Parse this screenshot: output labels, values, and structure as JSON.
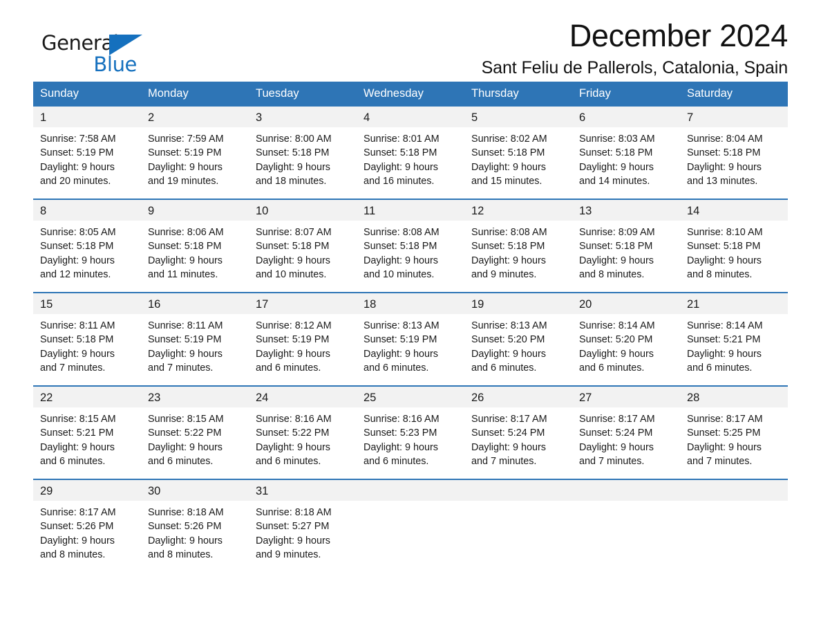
{
  "brand": {
    "name_top": "General",
    "name_bottom": "Blue",
    "accent_color": "#1570BE",
    "logo_icon": "triangle-logo-icon"
  },
  "header": {
    "month_title": "December 2024",
    "location": "Sant Feliu de Pallerols, Catalonia, Spain"
  },
  "theme": {
    "header_blue": "#2E75B6",
    "daynum_bg": "#F2F2F2",
    "text": "#1a1a1a"
  },
  "calendar": {
    "weekdays": [
      "Sunday",
      "Monday",
      "Tuesday",
      "Wednesday",
      "Thursday",
      "Friday",
      "Saturday"
    ],
    "weeks": [
      [
        {
          "day": "1",
          "sunrise": "Sunrise: 7:58 AM",
          "sunset": "Sunset: 5:19 PM",
          "daylight1": "Daylight: 9 hours",
          "daylight2": "and 20 minutes."
        },
        {
          "day": "2",
          "sunrise": "Sunrise: 7:59 AM",
          "sunset": "Sunset: 5:19 PM",
          "daylight1": "Daylight: 9 hours",
          "daylight2": "and 19 minutes."
        },
        {
          "day": "3",
          "sunrise": "Sunrise: 8:00 AM",
          "sunset": "Sunset: 5:18 PM",
          "daylight1": "Daylight: 9 hours",
          "daylight2": "and 18 minutes."
        },
        {
          "day": "4",
          "sunrise": "Sunrise: 8:01 AM",
          "sunset": "Sunset: 5:18 PM",
          "daylight1": "Daylight: 9 hours",
          "daylight2": "and 16 minutes."
        },
        {
          "day": "5",
          "sunrise": "Sunrise: 8:02 AM",
          "sunset": "Sunset: 5:18 PM",
          "daylight1": "Daylight: 9 hours",
          "daylight2": "and 15 minutes."
        },
        {
          "day": "6",
          "sunrise": "Sunrise: 8:03 AM",
          "sunset": "Sunset: 5:18 PM",
          "daylight1": "Daylight: 9 hours",
          "daylight2": "and 14 minutes."
        },
        {
          "day": "7",
          "sunrise": "Sunrise: 8:04 AM",
          "sunset": "Sunset: 5:18 PM",
          "daylight1": "Daylight: 9 hours",
          "daylight2": "and 13 minutes."
        }
      ],
      [
        {
          "day": "8",
          "sunrise": "Sunrise: 8:05 AM",
          "sunset": "Sunset: 5:18 PM",
          "daylight1": "Daylight: 9 hours",
          "daylight2": "and 12 minutes."
        },
        {
          "day": "9",
          "sunrise": "Sunrise: 8:06 AM",
          "sunset": "Sunset: 5:18 PM",
          "daylight1": "Daylight: 9 hours",
          "daylight2": "and 11 minutes."
        },
        {
          "day": "10",
          "sunrise": "Sunrise: 8:07 AM",
          "sunset": "Sunset: 5:18 PM",
          "daylight1": "Daylight: 9 hours",
          "daylight2": "and 10 minutes."
        },
        {
          "day": "11",
          "sunrise": "Sunrise: 8:08 AM",
          "sunset": "Sunset: 5:18 PM",
          "daylight1": "Daylight: 9 hours",
          "daylight2": "and 10 minutes."
        },
        {
          "day": "12",
          "sunrise": "Sunrise: 8:08 AM",
          "sunset": "Sunset: 5:18 PM",
          "daylight1": "Daylight: 9 hours",
          "daylight2": "and 9 minutes."
        },
        {
          "day": "13",
          "sunrise": "Sunrise: 8:09 AM",
          "sunset": "Sunset: 5:18 PM",
          "daylight1": "Daylight: 9 hours",
          "daylight2": "and 8 minutes."
        },
        {
          "day": "14",
          "sunrise": "Sunrise: 8:10 AM",
          "sunset": "Sunset: 5:18 PM",
          "daylight1": "Daylight: 9 hours",
          "daylight2": "and 8 minutes."
        }
      ],
      [
        {
          "day": "15",
          "sunrise": "Sunrise: 8:11 AM",
          "sunset": "Sunset: 5:18 PM",
          "daylight1": "Daylight: 9 hours",
          "daylight2": "and 7 minutes."
        },
        {
          "day": "16",
          "sunrise": "Sunrise: 8:11 AM",
          "sunset": "Sunset: 5:19 PM",
          "daylight1": "Daylight: 9 hours",
          "daylight2": "and 7 minutes."
        },
        {
          "day": "17",
          "sunrise": "Sunrise: 8:12 AM",
          "sunset": "Sunset: 5:19 PM",
          "daylight1": "Daylight: 9 hours",
          "daylight2": "and 6 minutes."
        },
        {
          "day": "18",
          "sunrise": "Sunrise: 8:13 AM",
          "sunset": "Sunset: 5:19 PM",
          "daylight1": "Daylight: 9 hours",
          "daylight2": "and 6 minutes."
        },
        {
          "day": "19",
          "sunrise": "Sunrise: 8:13 AM",
          "sunset": "Sunset: 5:20 PM",
          "daylight1": "Daylight: 9 hours",
          "daylight2": "and 6 minutes."
        },
        {
          "day": "20",
          "sunrise": "Sunrise: 8:14 AM",
          "sunset": "Sunset: 5:20 PM",
          "daylight1": "Daylight: 9 hours",
          "daylight2": "and 6 minutes."
        },
        {
          "day": "21",
          "sunrise": "Sunrise: 8:14 AM",
          "sunset": "Sunset: 5:21 PM",
          "daylight1": "Daylight: 9 hours",
          "daylight2": "and 6 minutes."
        }
      ],
      [
        {
          "day": "22",
          "sunrise": "Sunrise: 8:15 AM",
          "sunset": "Sunset: 5:21 PM",
          "daylight1": "Daylight: 9 hours",
          "daylight2": "and 6 minutes."
        },
        {
          "day": "23",
          "sunrise": "Sunrise: 8:15 AM",
          "sunset": "Sunset: 5:22 PM",
          "daylight1": "Daylight: 9 hours",
          "daylight2": "and 6 minutes."
        },
        {
          "day": "24",
          "sunrise": "Sunrise: 8:16 AM",
          "sunset": "Sunset: 5:22 PM",
          "daylight1": "Daylight: 9 hours",
          "daylight2": "and 6 minutes."
        },
        {
          "day": "25",
          "sunrise": "Sunrise: 8:16 AM",
          "sunset": "Sunset: 5:23 PM",
          "daylight1": "Daylight: 9 hours",
          "daylight2": "and 6 minutes."
        },
        {
          "day": "26",
          "sunrise": "Sunrise: 8:17 AM",
          "sunset": "Sunset: 5:24 PM",
          "daylight1": "Daylight: 9 hours",
          "daylight2": "and 7 minutes."
        },
        {
          "day": "27",
          "sunrise": "Sunrise: 8:17 AM",
          "sunset": "Sunset: 5:24 PM",
          "daylight1": "Daylight: 9 hours",
          "daylight2": "and 7 minutes."
        },
        {
          "day": "28",
          "sunrise": "Sunrise: 8:17 AM",
          "sunset": "Sunset: 5:25 PM",
          "daylight1": "Daylight: 9 hours",
          "daylight2": "and 7 minutes."
        }
      ],
      [
        {
          "day": "29",
          "sunrise": "Sunrise: 8:17 AM",
          "sunset": "Sunset: 5:26 PM",
          "daylight1": "Daylight: 9 hours",
          "daylight2": "and 8 minutes."
        },
        {
          "day": "30",
          "sunrise": "Sunrise: 8:18 AM",
          "sunset": "Sunset: 5:26 PM",
          "daylight1": "Daylight: 9 hours",
          "daylight2": "and 8 minutes."
        },
        {
          "day": "31",
          "sunrise": "Sunrise: 8:18 AM",
          "sunset": "Sunset: 5:27 PM",
          "daylight1": "Daylight: 9 hours",
          "daylight2": "and 9 minutes."
        },
        {
          "day": "",
          "sunrise": "",
          "sunset": "",
          "daylight1": "",
          "daylight2": ""
        },
        {
          "day": "",
          "sunrise": "",
          "sunset": "",
          "daylight1": "",
          "daylight2": ""
        },
        {
          "day": "",
          "sunrise": "",
          "sunset": "",
          "daylight1": "",
          "daylight2": ""
        },
        {
          "day": "",
          "sunrise": "",
          "sunset": "",
          "daylight1": "",
          "daylight2": ""
        }
      ]
    ]
  }
}
